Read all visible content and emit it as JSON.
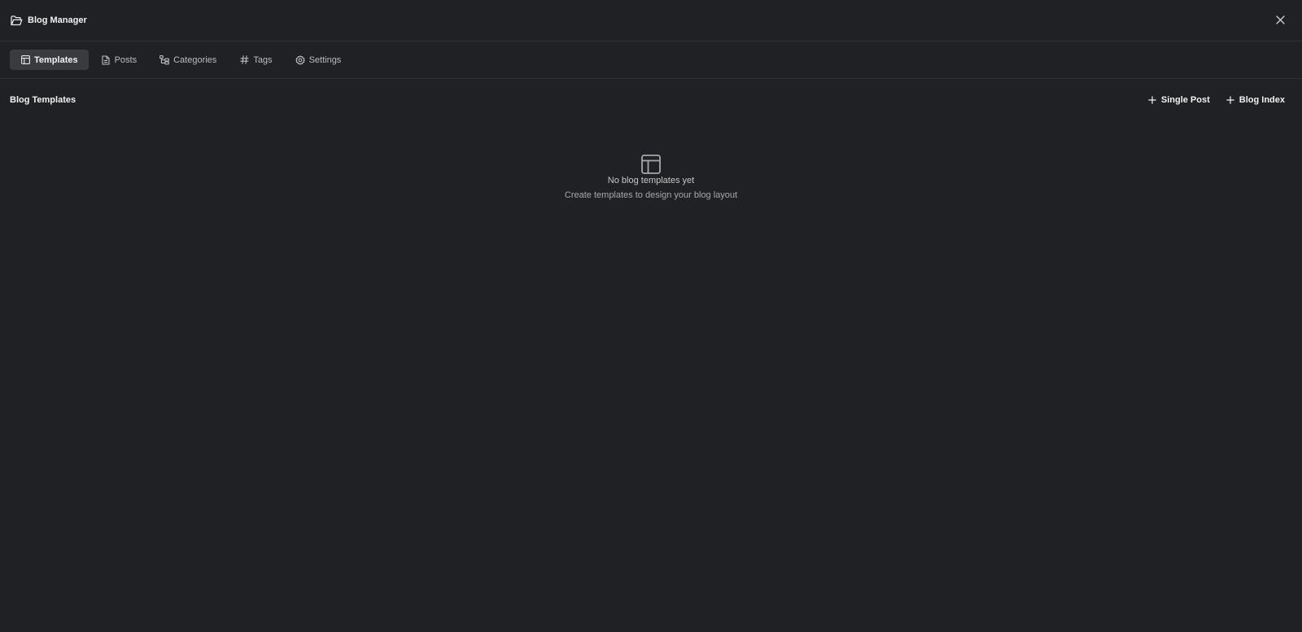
{
  "window": {
    "title": "Blog Manager",
    "title_icon": "folder-open-icon",
    "close_icon": "close-icon"
  },
  "tabs": [
    {
      "label": "Templates",
      "icon": "layout-icon",
      "active": true
    },
    {
      "label": "Posts",
      "icon": "document-icon",
      "active": false
    },
    {
      "label": "Categories",
      "icon": "category-tree-icon",
      "active": false
    },
    {
      "label": "Tags",
      "icon": "hash-icon",
      "active": false
    },
    {
      "label": "Settings",
      "icon": "gear-icon",
      "active": false
    }
  ],
  "section": {
    "title": "Blog Templates",
    "actions": [
      {
        "label": "Single Post",
        "icon": "plus-icon"
      },
      {
        "label": "Blog Index",
        "icon": "plus-icon"
      }
    ]
  },
  "empty_state": {
    "icon": "layout-icon",
    "title": "No blog templates yet",
    "subtitle": "Create templates to design your blog layout"
  },
  "colors": {
    "background": "#202124",
    "active_tab": "#3a3b3e",
    "border": "#2f3033",
    "text_primary": "#f2f2f2",
    "text_muted": "#a8a8a8"
  }
}
